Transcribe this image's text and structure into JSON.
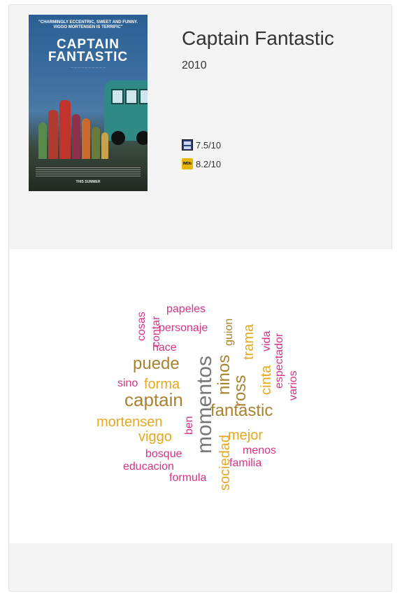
{
  "movie": {
    "title": "Captain Fantastic",
    "year": "2010",
    "ratings": [
      {
        "source_icon": "filmaffinity-icon",
        "value": "7.5/10"
      },
      {
        "source_icon": "imdb-icon",
        "value": "8.2/10"
      }
    ]
  },
  "poster": {
    "quote": "\"CHARMINGLY ECCENTRIC, SWEET AND FUNNY. VIGGO MORTENSEN IS TERRIFIC\"",
    "title": "CAPTAIN FANTASTIC",
    "release": "THIS SUMMER"
  },
  "icons": {
    "imdb_text": "IMDb"
  },
  "colors": {
    "magenta": "#d63384",
    "gold": "#e3a920",
    "brown": "#a9832f",
    "grey": "#777777"
  },
  "word_cloud": {
    "words": [
      "papeles",
      "cosas",
      "contar",
      "personaje",
      "guion",
      "trama",
      "vida",
      "espectador",
      "hace",
      "puede",
      "ninos",
      "cinta",
      "varios",
      "momentos",
      "sino",
      "forma",
      "ross",
      "captain",
      "fantastic",
      "mortensen",
      "ben",
      "viggo",
      "mejor",
      "bosque",
      "sociedad",
      "menos",
      "familia",
      "educacion",
      "formula"
    ]
  }
}
